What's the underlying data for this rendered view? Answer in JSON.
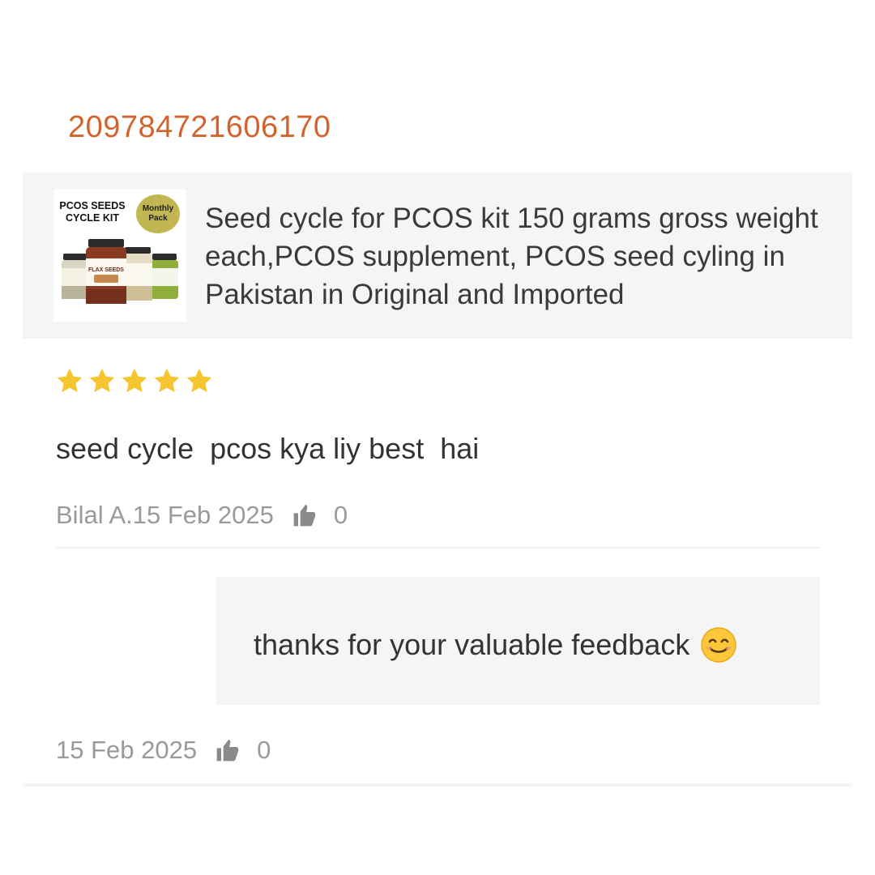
{
  "order": {
    "id": "209784721606170"
  },
  "product": {
    "title": "Seed cycle for PCOS kit 150 grams gross weight each,PCOS supplement, PCOS seed cyling in Pakistan in Original and Imported",
    "thumbnail": {
      "title": "PCOS SEEDS CYCLE KIT",
      "badge": "Monthly Pack",
      "jar_labels": [
        "FLAX SEEDS"
      ]
    }
  },
  "review": {
    "rating": 5,
    "rating_max": 5,
    "star_color": "#f7c531",
    "text": "seed cycle  pcos kya liy best  hai",
    "author_date": "Bilal A.15 Feb 2025",
    "likes": "0"
  },
  "seller_reply": {
    "text": "thanks for your valuable feedback",
    "emoji_icon": "smiling-face-icon",
    "date": "15 Feb 2025",
    "likes": "0"
  },
  "colors": {
    "order_id": "#d2652d",
    "card_bg": "#f5f5f5",
    "meta_text": "#9a9a9a"
  }
}
